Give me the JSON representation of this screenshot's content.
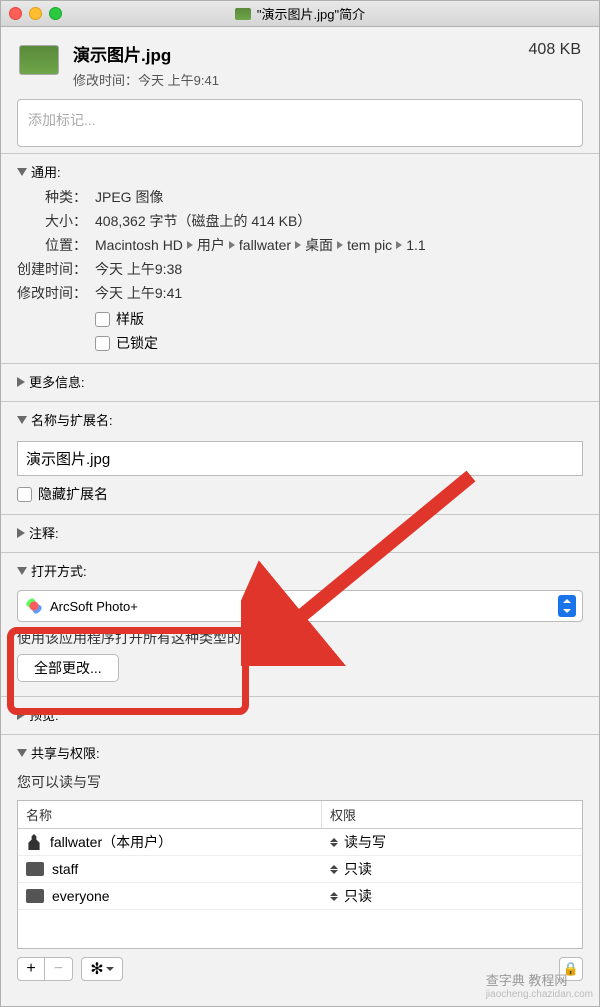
{
  "window": {
    "title": "\"演示图片.jpg\"简介"
  },
  "header": {
    "filename": "演示图片.jpg",
    "modified_label": "修改时间：",
    "modified_value": "今天 上午9:41",
    "size": "408 KB"
  },
  "tags": {
    "placeholder": "添加标记..."
  },
  "general": {
    "title": "通用:",
    "kind_label": "种类：",
    "kind_value": "JPEG 图像",
    "size_label": "大小：",
    "size_value": "408,362 字节（磁盘上的 414 KB）",
    "where_label": "位置：",
    "where_parts": [
      "Macintosh HD",
      "用户",
      "fallwater",
      "桌面",
      "tem pic",
      "1.1"
    ],
    "created_label": "创建时间：",
    "created_value": "今天 上午9:38",
    "modified_label": "修改时间：",
    "modified_value": "今天 上午9:41",
    "stationery_label": "样版",
    "locked_label": "已锁定"
  },
  "moreinfo": {
    "title": "更多信息:"
  },
  "nameext": {
    "title": "名称与扩展名:",
    "filename": "演示图片.jpg",
    "hide_ext_label": "隐藏扩展名"
  },
  "comments": {
    "title": "注释:"
  },
  "openwith": {
    "title": "打开方式:",
    "app": "ArcSoft Photo+",
    "helper": "使用该应用程序打开所有这种类型的文稿。",
    "changeall": "全部更改..."
  },
  "preview": {
    "title": "预览:"
  },
  "sharing": {
    "title": "共享与权限:",
    "you_can": "您可以读与写",
    "col_name": "名称",
    "col_priv": "权限",
    "rows": [
      {
        "name": "fallwater（本用户）",
        "priv": "读与写"
      },
      {
        "name": "staff",
        "priv": "只读"
      },
      {
        "name": "everyone",
        "priv": "只读"
      }
    ]
  },
  "watermark": {
    "line1": "查字典 教程网",
    "line2": "jiaocheng.chazidan.com"
  }
}
